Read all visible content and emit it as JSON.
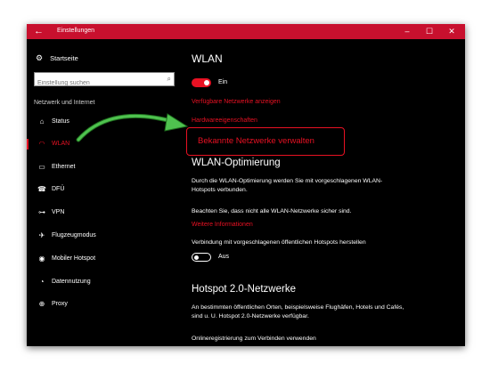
{
  "window": {
    "title": "Einstellungen",
    "back_icon": "←",
    "minimize_icon": "–",
    "maximize_icon": "☐",
    "close_icon": "✕"
  },
  "sidebar": {
    "home": {
      "label": "Startseite",
      "icon": "⚙"
    },
    "search_placeholder": "Einstellung suchen",
    "search_icon": "⌕",
    "section_label": "Netzwerk und Internet",
    "items": [
      {
        "label": "Status",
        "icon": "⌂"
      },
      {
        "label": "WLAN",
        "icon": "◠"
      },
      {
        "label": "Ethernet",
        "icon": "▭"
      },
      {
        "label": "DFÜ",
        "icon": "☎"
      },
      {
        "label": "VPN",
        "icon": "⊶"
      },
      {
        "label": "Flugzeugmodus",
        "icon": "✈"
      },
      {
        "label": "Mobiler Hotspot",
        "icon": "◉"
      },
      {
        "label": "Datennutzung",
        "icon": "◔"
      },
      {
        "label": "Proxy",
        "icon": "⊕"
      }
    ],
    "active_index": 1
  },
  "main": {
    "title": "WLAN",
    "wifi_toggle": {
      "state_label": "Ein",
      "on": true
    },
    "link_show_networks": "Verfügbare Netzwerke anzeigen",
    "link_hardware": "Hardwareeigenschaften",
    "link_manage_known": "Bekannte Netzwerke verwalten",
    "optimization": {
      "heading": "WLAN-Optimierung",
      "desc1": "Durch die WLAN-Optimierung werden Sie mit vorgeschlagenen WLAN-Hotspots verbunden.",
      "desc2": "Beachten Sie, dass nicht alle WLAN-Netzwerke sicher sind.",
      "more_info": "Weitere Informationen",
      "connect_label": "Verbindung mit vorgeschlagenen öffentlichen Hotspots herstellen",
      "toggle_state_label": "Aus",
      "toggle_on": false
    },
    "hotspot20": {
      "heading": "Hotspot 2.0-Netzwerke",
      "desc": "An bestimmten öffentlichen Orten, beispielsweise Flughäfen, Hotels und Cafés, sind u. U. Hotspot 2.0-Netzwerke verfügbar.",
      "online_reg": "Onlineregistrierung zum Verbinden verwenden"
    }
  },
  "colors": {
    "accent": "#e81123",
    "titlebar": "#c8102e",
    "background": "#000000",
    "annotation_arrow": "#2e8b2e"
  }
}
